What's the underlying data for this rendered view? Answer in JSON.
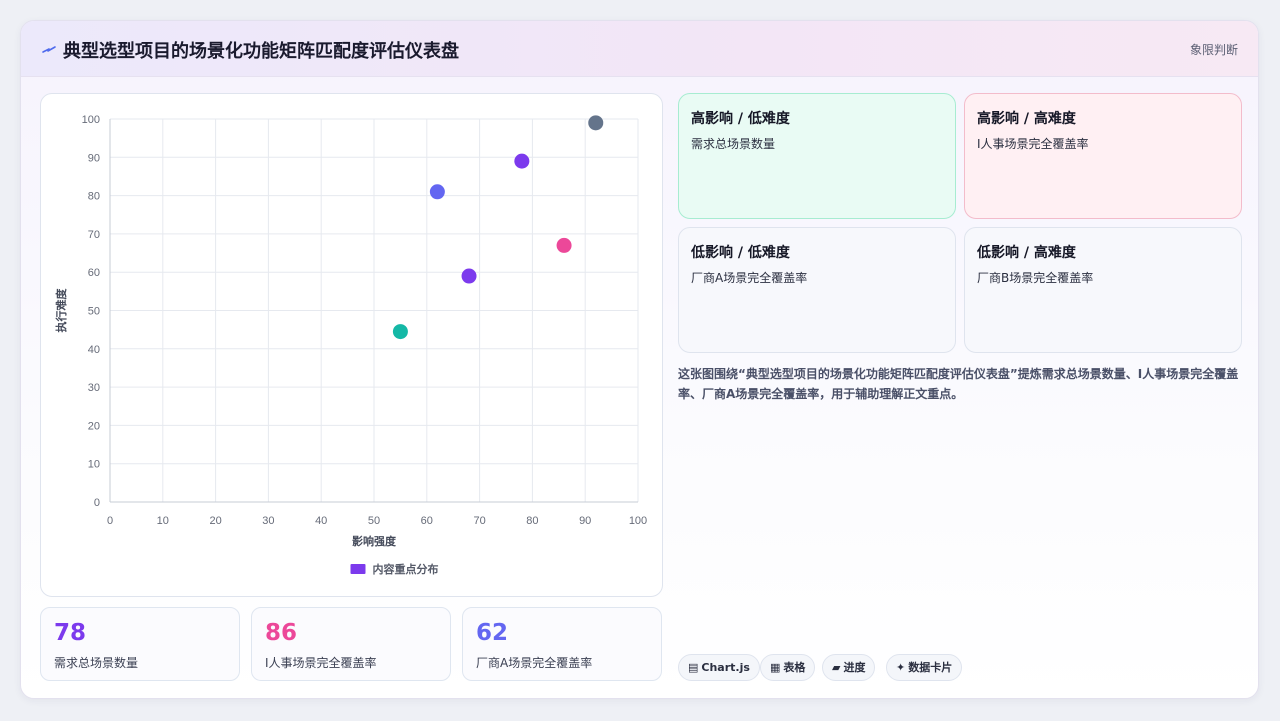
{
  "header": {
    "title": "典型选型项目的场景化功能矩阵匹配度评估仪表盘",
    "tag": "象限判断"
  },
  "chart_data": {
    "type": "scatter",
    "xlabel": "影响强度",
    "ylabel": "执行难度",
    "xlim": [
      0,
      100
    ],
    "ylim": [
      0,
      100
    ],
    "xticks": [
      0,
      10,
      20,
      30,
      40,
      50,
      60,
      70,
      80,
      90,
      100
    ],
    "yticks": [
      0,
      10,
      20,
      30,
      40,
      50,
      60,
      70,
      80,
      90,
      100
    ],
    "grid": true,
    "legend": {
      "position": "bottom",
      "label": "内容重点分布",
      "color": "#7c3aed"
    },
    "points": [
      {
        "x": 55,
        "y": 44.5,
        "color": "#14b8a6"
      },
      {
        "x": 62,
        "y": 81,
        "color": "#6366f1"
      },
      {
        "x": 68,
        "y": 59,
        "color": "#7c3aed"
      },
      {
        "x": 78,
        "y": 89,
        "color": "#7c3aed"
      },
      {
        "x": 86,
        "y": 67,
        "color": "#ec4899"
      },
      {
        "x": 92,
        "y": 99,
        "color": "#64748b"
      }
    ]
  },
  "stats": [
    {
      "value": "78",
      "label": "需求总场景数量",
      "color": "#7c3aed"
    },
    {
      "value": "86",
      "label": "I人事场景完全覆盖率",
      "color": "#ec4899"
    },
    {
      "value": "62",
      "label": "厂商A场景完全覆盖率",
      "color": "#6366f1"
    }
  ],
  "quadrants": [
    {
      "title": "高影响 / 低难度",
      "body": "需求总场景数量"
    },
    {
      "title": "高影响 / 高难度",
      "body": "I人事场景完全覆盖率"
    },
    {
      "title": "低影响 / 低难度",
      "body": "厂商A场景完全覆盖率"
    },
    {
      "title": "低影响 / 高难度",
      "body": "厂商B场景完全覆盖率"
    }
  ],
  "description": "这张图围绕“典型选型项目的场景化功能矩阵匹配度评估仪表盘”提炼需求总场景数量、I人事场景完全覆盖率、厂商A场景完全覆盖率，用于辅助理解正文重点。",
  "chips": [
    {
      "icon": "▤",
      "label": "Chart.js",
      "icon_name": "chart-icon"
    },
    {
      "icon": "▦",
      "label": "表格",
      "icon_name": "table-icon"
    },
    {
      "icon": "▰",
      "label": "进度",
      "icon_name": "progress-icon"
    },
    {
      "icon": "✦",
      "label": "数据卡片",
      "icon_name": "sparkle-icon"
    }
  ]
}
